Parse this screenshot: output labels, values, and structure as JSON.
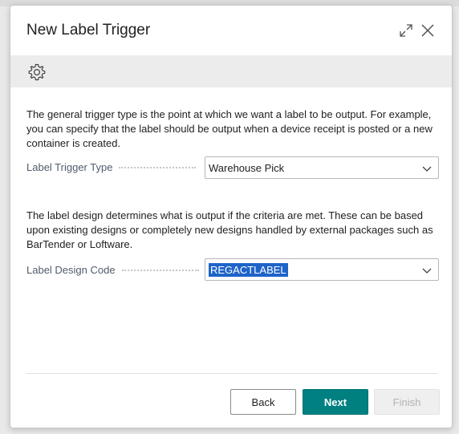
{
  "dialog": {
    "title": "New Label Trigger"
  },
  "icons": {
    "expand": "expand-icon",
    "close": "close-icon",
    "settings": "gear-icon",
    "dropdown": "chevron-down-icon"
  },
  "section1": {
    "description": "The general trigger type is the point at which we want a label to be output. For example, you can specify that the label should be output when a device receipt is posted or a new container is created.",
    "field_label": "Label Trigger Type",
    "field_value": "Warehouse Pick"
  },
  "section2": {
    "description": "The label design determines what is output if the criteria are met. These can be based upon existing designs or completely new designs handled by external packages such as BarTender or Loftware.",
    "field_label": "Label Design Code",
    "field_value": "REGACTLABEL"
  },
  "buttons": {
    "back": "Back",
    "next": "Next",
    "finish": "Finish"
  },
  "colors": {
    "accent": "#008080",
    "selection": "#1e64c8",
    "disabled_text": "#b3b3b3"
  }
}
